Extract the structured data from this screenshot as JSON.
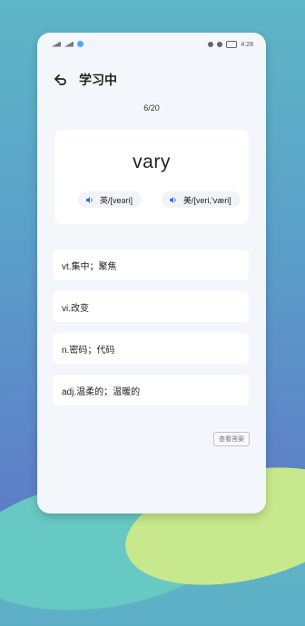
{
  "status": {
    "time": "4:28"
  },
  "header": {
    "title": "学习中",
    "back_icon": "back-arrow-icon"
  },
  "progress": "6/20",
  "word": "vary",
  "pronunciations": [
    {
      "label": "英/[veəri]",
      "icon": "speaker-icon"
    },
    {
      "label": "美/[veri,'væri]",
      "icon": "speaker-icon"
    }
  ],
  "options": [
    "vt.集中；聚焦",
    "vi.改变",
    "n.密码；代码",
    "adj.温柔的；温暖的"
  ],
  "reveal_button": "查看答案",
  "colors": {
    "accent": "#3b6fe0",
    "card": "#ffffff",
    "screen": "#f3f6fb"
  }
}
